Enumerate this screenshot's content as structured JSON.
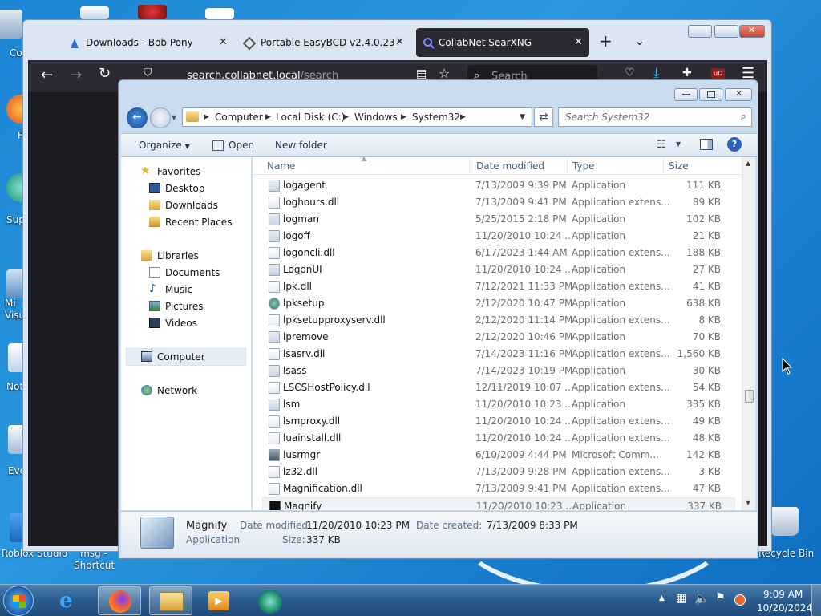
{
  "desktop": {
    "icons": [
      {
        "label": "Co",
        "name": "computer"
      },
      {
        "label": "F",
        "name": "firefox"
      },
      {
        "label": "Sup",
        "name": "support"
      },
      {
        "label": "Mi Visu",
        "name": "visual-studio"
      },
      {
        "label": "Not",
        "name": "notepad"
      },
      {
        "label": "Eve",
        "name": "event-viewer"
      },
      {
        "label": "Roblox Studio",
        "name": "roblox-studio"
      },
      {
        "label": "msg - Shortcut",
        "name": "msg-shortcut"
      },
      {
        "label": "Recycle Bin",
        "name": "recycle-bin"
      }
    ]
  },
  "firefox": {
    "tabs": [
      {
        "label": "Downloads - Bob Pony",
        "selected": false
      },
      {
        "label": "Portable EasyBCD v2.4.0.237 Co",
        "selected": false
      },
      {
        "label": "CollabNet SearXNG",
        "selected": true
      }
    ],
    "new_tab": "+",
    "tab_list": "⌄",
    "url_host": "search.collabnet.local",
    "url_path": "/search",
    "search_placeholder": "Search",
    "ublock_badge": "uD"
  },
  "explorer": {
    "breadcrumb": [
      "Computer",
      "Local Disk (C:)",
      "Windows",
      "System32"
    ],
    "search_placeholder": "Search System32",
    "toolbar": {
      "organize": "Organize",
      "open": "Open",
      "new_folder": "New folder"
    },
    "nav": {
      "favorites": "Favorites",
      "desktop": "Desktop",
      "downloads": "Downloads",
      "recent": "Recent Places",
      "libraries": "Libraries",
      "documents": "Documents",
      "music": "Music",
      "pictures": "Pictures",
      "videos": "Videos",
      "computer": "Computer",
      "network": "Network"
    },
    "columns": {
      "name": "Name",
      "date": "Date modified",
      "type": "Type",
      "size": "Size"
    },
    "files": [
      {
        "name": "logagent",
        "date": "7/13/2009 9:39 PM",
        "type": "Application",
        "size": "111 KB",
        "icon": "exe"
      },
      {
        "name": "loghours.dll",
        "date": "7/13/2009 9:41 PM",
        "type": "Application extens...",
        "size": "89 KB",
        "icon": "dll"
      },
      {
        "name": "logman",
        "date": "5/25/2015 2:18 PM",
        "type": "Application",
        "size": "102 KB",
        "icon": "exe"
      },
      {
        "name": "logoff",
        "date": "11/20/2010 10:24 ...",
        "type": "Application",
        "size": "21 KB",
        "icon": "exe"
      },
      {
        "name": "logoncli.dll",
        "date": "6/17/2023 1:44 AM",
        "type": "Application extens...",
        "size": "188 KB",
        "icon": "dll"
      },
      {
        "name": "LogonUI",
        "date": "11/20/2010 10:24 ...",
        "type": "Application",
        "size": "27 KB",
        "icon": "exe"
      },
      {
        "name": "lpk.dll",
        "date": "7/12/2021 11:33 PM",
        "type": "Application extens...",
        "size": "41 KB",
        "icon": "dll"
      },
      {
        "name": "lpksetup",
        "date": "2/12/2020 10:47 PM",
        "type": "Application",
        "size": "638 KB",
        "icon": "globe"
      },
      {
        "name": "lpksetupproxyserv.dll",
        "date": "2/12/2020 11:14 PM",
        "type": "Application extens...",
        "size": "8 KB",
        "icon": "dll"
      },
      {
        "name": "lpremove",
        "date": "2/12/2020 10:46 PM",
        "type": "Application",
        "size": "70 KB",
        "icon": "exe"
      },
      {
        "name": "lsasrv.dll",
        "date": "7/14/2023 11:16 PM",
        "type": "Application extens...",
        "size": "1,560 KB",
        "icon": "dll"
      },
      {
        "name": "lsass",
        "date": "7/14/2023 10:19 PM",
        "type": "Application",
        "size": "30 KB",
        "icon": "exe"
      },
      {
        "name": "LSCSHostPolicy.dll",
        "date": "12/11/2019 10:07 ...",
        "type": "Application extens...",
        "size": "54 KB",
        "icon": "dll"
      },
      {
        "name": "lsm",
        "date": "11/20/2010 10:23 ...",
        "type": "Application",
        "size": "335 KB",
        "icon": "exe"
      },
      {
        "name": "lsmproxy.dll",
        "date": "11/20/2010 10:24 ...",
        "type": "Application extens...",
        "size": "49 KB",
        "icon": "dll"
      },
      {
        "name": "luainstall.dll",
        "date": "11/20/2010 10:24 ...",
        "type": "Application extens...",
        "size": "48 KB",
        "icon": "dll"
      },
      {
        "name": "lusrmgr",
        "date": "6/10/2009 4:44 PM",
        "type": "Microsoft Comm...",
        "size": "142 KB",
        "icon": "msc"
      },
      {
        "name": "lz32.dll",
        "date": "7/13/2009 9:28 PM",
        "type": "Application extens...",
        "size": "3 KB",
        "icon": "dll"
      },
      {
        "name": "Magnification.dll",
        "date": "7/13/2009 9:41 PM",
        "type": "Application extens...",
        "size": "47 KB",
        "icon": "dll"
      },
      {
        "name": "Magnify",
        "date": "11/20/2010 10:23 ...",
        "type": "Application",
        "size": "337 KB",
        "icon": "cmd"
      }
    ],
    "selected_index": 19,
    "details": {
      "name": "Magnify",
      "type": "Application",
      "date_modified_label": "Date modified:",
      "date_modified": "11/20/2010 10:23 PM",
      "date_created_label": "Date created:",
      "date_created": "7/13/2009 8:33 PM",
      "size_label": "Size:",
      "size": "337 KB"
    }
  },
  "taskbar": {
    "clock_time": "9:09 AM",
    "clock_date": "10/20/2024",
    "apps": [
      "start",
      "internet-explorer",
      "firefox",
      "file-explorer",
      "media-player",
      "collabnet-app"
    ]
  }
}
